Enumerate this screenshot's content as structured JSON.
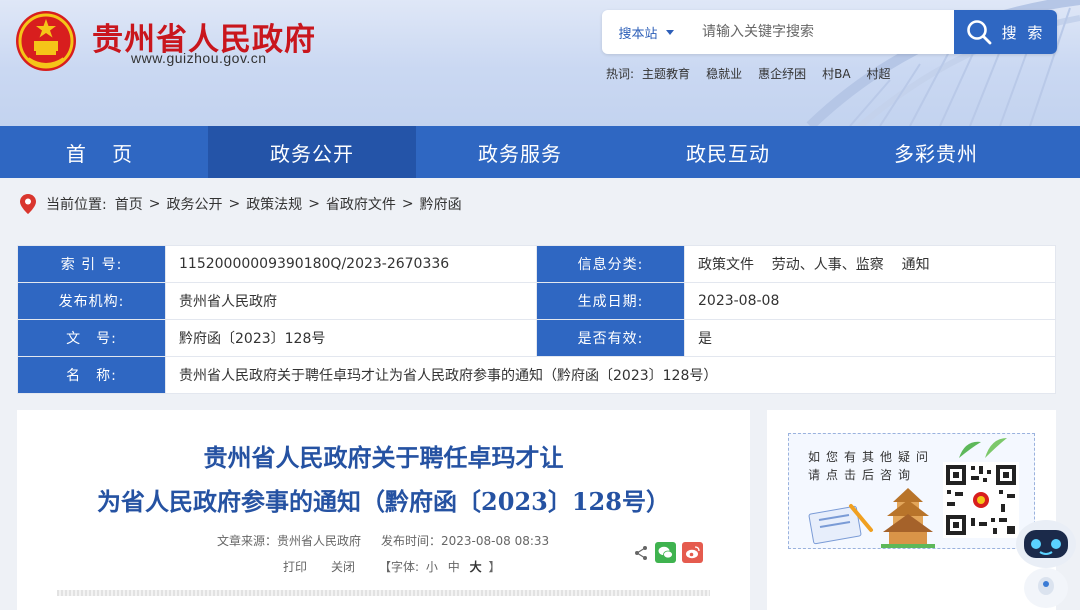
{
  "header": {
    "site_title": "贵州省人民政府",
    "site_url": "www.guizhou.gov.cn",
    "search": {
      "scope": "搜本站",
      "placeholder": "请输入关键字搜索",
      "button": "搜 索"
    },
    "hotwords": {
      "label": "热词:",
      "items": [
        "主题教育",
        "稳就业",
        "惠企纾困",
        "村BA",
        "村超"
      ]
    }
  },
  "nav": {
    "items": [
      "首 页",
      "政务公开",
      "政务服务",
      "政民互动",
      "多彩贵州"
    ],
    "active_index": 1
  },
  "breadcrumb": {
    "label": "当前位置:",
    "items": [
      "首页",
      "政务公开",
      "政策法规",
      "省政府文件",
      "黔府函"
    ]
  },
  "info": {
    "index_label": "索 引 号:",
    "index_value": "11520000009390180Q/2023-2670336",
    "category_label": "信息分类:",
    "category_value": "政策文件    劳动、人事、监察    通知",
    "publisher_label": "发布机构:",
    "publisher_value": "贵州省人民政府",
    "date_label": "生成日期:",
    "date_value": "2023-08-08",
    "docno_label": "文　号:",
    "docno_value": "黔府函〔2023〕128号",
    "valid_label": "是否有效:",
    "valid_value": "是",
    "name_label": "名　称:",
    "name_value": "贵州省人民政府关于聘任卓玛才让为省人民政府参事的通知（黔府函〔2023〕128号）"
  },
  "article": {
    "title_line1": "贵州省人民政府关于聘任卓玛才让",
    "title_line2": "为省人民政府参事的通知（黔府函〔2023〕128号）",
    "source": "文章来源：贵州省人民政府",
    "publish_time": "发布时间：2023-08-08 08:33",
    "print": "打印",
    "close": "关闭",
    "font_label": "【字体:",
    "font_small": "小",
    "font_medium": "中",
    "font_large": "大",
    "font_end": "】"
  },
  "side": {
    "qa_line1": "如您有其他疑问",
    "qa_line2": "请点击后咨询"
  },
  "colors": {
    "brand_blue": "#2f67c2",
    "title_red": "#c9161d",
    "article_title_blue": "#2552a2"
  }
}
